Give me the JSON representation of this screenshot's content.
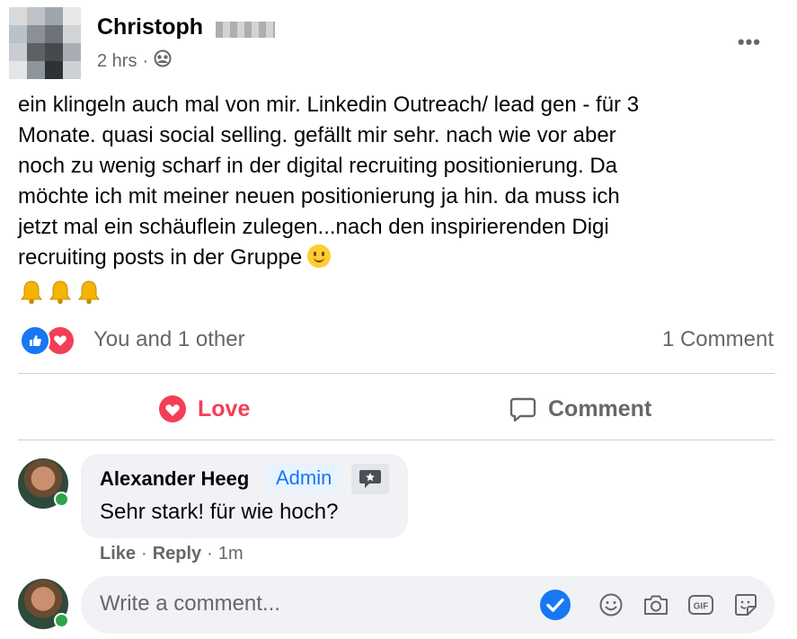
{
  "post": {
    "author": "Christoph",
    "time": "2 hrs",
    "audience_icon": "group-icon",
    "more_label": "•••",
    "text_lines": [
      "ein klingeln auch mal von mir. Linkedin Outreach/ lead gen - für 3",
      "Monate. quasi social selling. gefällt mir sehr. nach wie vor aber",
      "noch zu wenig scharf in der digital recruiting positionierung. Da",
      "möchte ich mit meiner neuen positionierung ja hin. da muss ich",
      "jetzt mal ein schäuflein zulegen...nach den inspirierenden Digi",
      "recruiting posts in der Gruppe"
    ],
    "bell_emojis": [
      "bell-icon",
      "bell-icon",
      "bell-icon"
    ]
  },
  "reactions": {
    "summary": "You and 1 other",
    "comment_count": "1 Comment"
  },
  "actions": {
    "love_label": "Love",
    "comment_label": "Comment"
  },
  "comment": {
    "author": "Alexander Heeg",
    "badge": "Admin",
    "text": "Sehr stark! für wie hoch?",
    "like_label": "Like",
    "reply_label": "Reply",
    "time": "1m",
    "separator": "·"
  },
  "composer": {
    "placeholder": "Write a comment..."
  },
  "colors": {
    "like_blue": "#1877f2",
    "love_red": "#f33e58",
    "online_green": "#31a24c",
    "bubble_gray": "#f0f2f5",
    "secondary_text": "#65676b"
  }
}
